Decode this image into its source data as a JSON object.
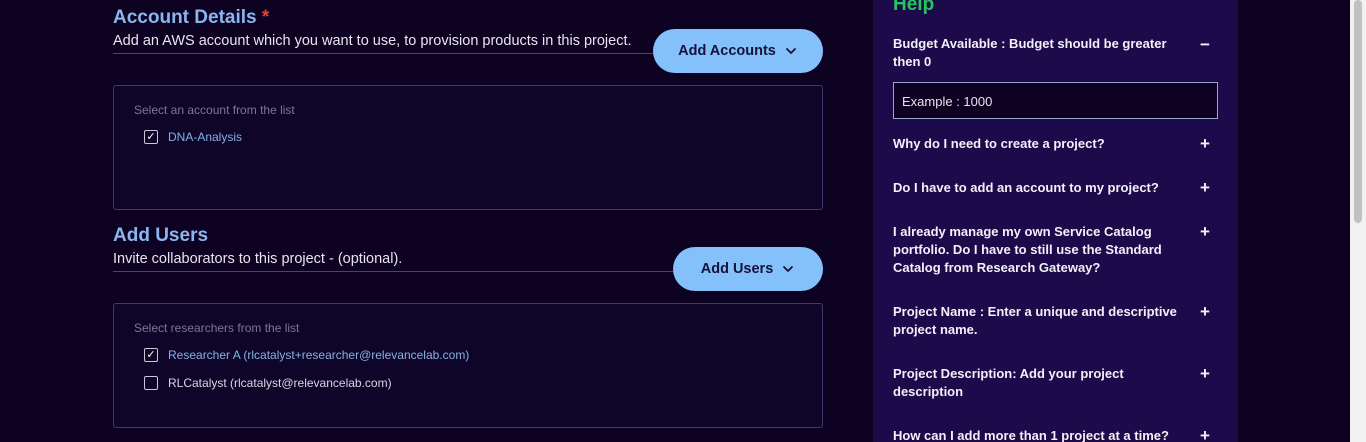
{
  "account": {
    "title": "Account Details",
    "required_mark": "*",
    "description": "Add an AWS account which you want to use, to provision products in this project.",
    "add_button": "Add Accounts",
    "box_label": "Select an account from the list",
    "items": [
      {
        "label": "DNA-Analysis",
        "checked": true
      }
    ]
  },
  "users": {
    "title": "Add Users",
    "description": "Invite collaborators to this project - (optional).",
    "add_button": "Add Users",
    "box_label": "Select researchers from the list",
    "items": [
      {
        "label": "Researcher A (rlcatalyst+researcher@relevancelab.com)",
        "checked": true
      },
      {
        "label": "RLCatalyst (rlcatalyst@relevancelab.com)",
        "checked": false
      }
    ]
  },
  "help": {
    "title": "Help",
    "items": [
      {
        "q": "Budget Available : Budget should be greater then 0",
        "toggle": "−",
        "expanded": true,
        "answer": "Example : 1000"
      },
      {
        "q": "Why do I need to create a project?",
        "toggle": "+"
      },
      {
        "q": "Do I have to add an account to my project?",
        "toggle": "+"
      },
      {
        "q": "I already manage my own Service Catalog portfolio. Do I have to still use the Standard Catalog from Research Gateway?",
        "toggle": "+"
      },
      {
        "q": "Project Name : Enter a unique and descriptive project name.",
        "toggle": "+"
      },
      {
        "q": "Project Description: Add your project description",
        "toggle": "+"
      },
      {
        "q": "How can I add more than 1 project at a time?",
        "toggle": "+"
      }
    ]
  },
  "colors": {
    "background": "#0d0221",
    "accent_button": "#84c1fa",
    "section_title": "#8ab6f0",
    "help_title": "#22c55e",
    "help_panel": "#1c0a4a",
    "required": "#e0453a"
  },
  "icons": {
    "chevron": "chevron-down-icon",
    "checkbox_checked": "checkmark-icon"
  }
}
